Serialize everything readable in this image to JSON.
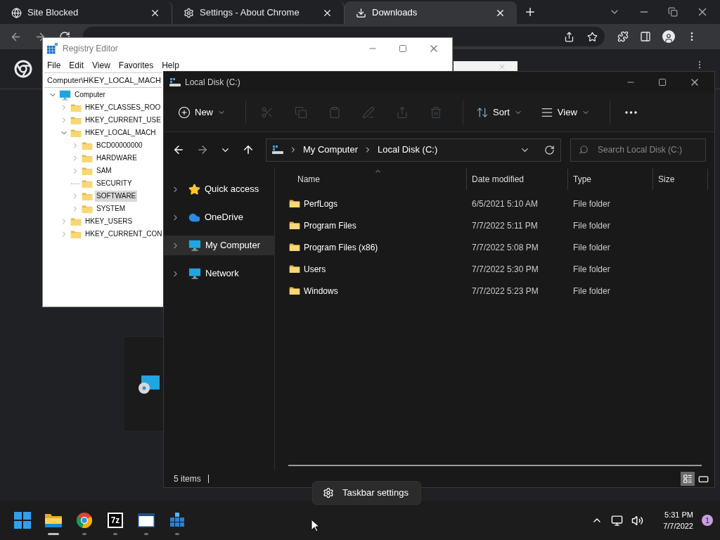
{
  "browser": {
    "tabs": [
      {
        "title": "Site Blocked",
        "kind": "globe",
        "selected": false
      },
      {
        "title": "Settings - About Chrome",
        "kind": "settings",
        "selected": false
      },
      {
        "title": "Downloads",
        "kind": "download",
        "selected": true
      }
    ]
  },
  "registry_editor": {
    "title": "Registry Editor",
    "menu": [
      "File",
      "Edit",
      "View",
      "Favorites",
      "Help"
    ],
    "address": "Computer\\HKEY_LOCAL_MACH",
    "tree": [
      {
        "label": "Computer",
        "kind": "computer",
        "expandable": true,
        "expanded": true,
        "selected": false,
        "children": [
          {
            "label": "HKEY_CLASSES_ROO",
            "kind": "folder",
            "expandable": true,
            "expanded": false,
            "selected": false
          },
          {
            "label": "HKEY_CURRENT_USE",
            "kind": "folder",
            "expandable": true,
            "expanded": false,
            "selected": false
          },
          {
            "label": "HKEY_LOCAL_MACH",
            "kind": "folder",
            "expandable": true,
            "expanded": true,
            "selected": false,
            "children": [
              {
                "label": "BCD00000000",
                "kind": "folder",
                "expandable": true,
                "expanded": false,
                "selected": false
              },
              {
                "label": "HARDWARE",
                "kind": "folder",
                "expandable": true,
                "expanded": false,
                "selected": false
              },
              {
                "label": "SAM",
                "kind": "folder",
                "expandable": true,
                "expanded": false,
                "selected": false
              },
              {
                "label": "SECURITY",
                "kind": "folder",
                "expandable": false,
                "expanded": false,
                "selected": false
              },
              {
                "label": "SOFTWARE",
                "kind": "folder",
                "expandable": true,
                "expanded": false,
                "selected": true
              },
              {
                "label": "SYSTEM",
                "kind": "folder",
                "expandable": true,
                "expanded": false,
                "selected": false
              }
            ]
          },
          {
            "label": "HKEY_USERS",
            "kind": "folder",
            "expandable": true,
            "expanded": false,
            "selected": false
          },
          {
            "label": "HKEY_CURRENT_CON",
            "kind": "folder",
            "expandable": true,
            "expanded": false,
            "selected": false
          }
        ]
      }
    ]
  },
  "explorer": {
    "title": "Local Disk (C:)",
    "toolbar": [
      {
        "kind": "new",
        "label": "New",
        "disabled": false
      },
      {
        "kind": "cut",
        "disabled": true
      },
      {
        "kind": "copy",
        "disabled": true
      },
      {
        "kind": "paste",
        "disabled": true
      },
      {
        "kind": "rename",
        "disabled": true
      },
      {
        "kind": "share",
        "disabled": true
      },
      {
        "kind": "delete",
        "disabled": true
      },
      {
        "kind": "sort",
        "label": "Sort",
        "disabled": false
      },
      {
        "kind": "view",
        "label": "View",
        "disabled": false
      },
      {
        "kind": "more",
        "disabled": false
      }
    ],
    "breadcrumb": [
      "My Computer",
      "Local Disk (C:)"
    ],
    "search": {
      "placeholder": "Search Local Disk (C:)"
    },
    "sidebar": [
      {
        "label": "Quick access",
        "kind": "star",
        "selected": false
      },
      {
        "label": "OneDrive",
        "kind": "cloud",
        "selected": false
      },
      {
        "label": "My Computer",
        "kind": "computer",
        "selected": true
      },
      {
        "label": "Network",
        "kind": "network",
        "selected": false
      }
    ],
    "columns": [
      {
        "label": "Name",
        "sorted": true
      },
      {
        "label": "Date modified",
        "sorted": false
      },
      {
        "label": "Type",
        "sorted": false
      },
      {
        "label": "Size",
        "sorted": false
      }
    ],
    "rows": [
      {
        "name": "PerfLogs",
        "date": "6/5/2021 5:10 AM",
        "type": "File folder"
      },
      {
        "name": "Program Files",
        "date": "7/7/2022 5:11 PM",
        "type": "File folder"
      },
      {
        "name": "Program Files (x86)",
        "date": "7/7/2022 5:08 PM",
        "type": "File folder"
      },
      {
        "name": "Users",
        "date": "7/7/2022 5:30 PM",
        "type": "File folder"
      },
      {
        "name": "Windows",
        "date": "7/7/2022 5:23 PM",
        "type": "File folder"
      }
    ],
    "status": "5 items",
    "view_modes": [
      {
        "kind": "details",
        "selected": true
      },
      {
        "kind": "tiles",
        "selected": false
      }
    ]
  },
  "popup": {
    "label": "Taskbar settings"
  },
  "taskbar": {
    "apps": [
      {
        "kind": "start",
        "open": false,
        "active": false
      },
      {
        "kind": "explorer",
        "open": true,
        "active": true
      },
      {
        "kind": "chrome",
        "open": true,
        "active": false
      },
      {
        "kind": "archiver",
        "label": "7z",
        "open": true,
        "active": false
      },
      {
        "kind": "window",
        "open": true,
        "active": false
      },
      {
        "kind": "registry",
        "open": true,
        "active": false
      }
    ],
    "time": "5:31 PM",
    "date": "7/7/2022",
    "badge": "1"
  }
}
